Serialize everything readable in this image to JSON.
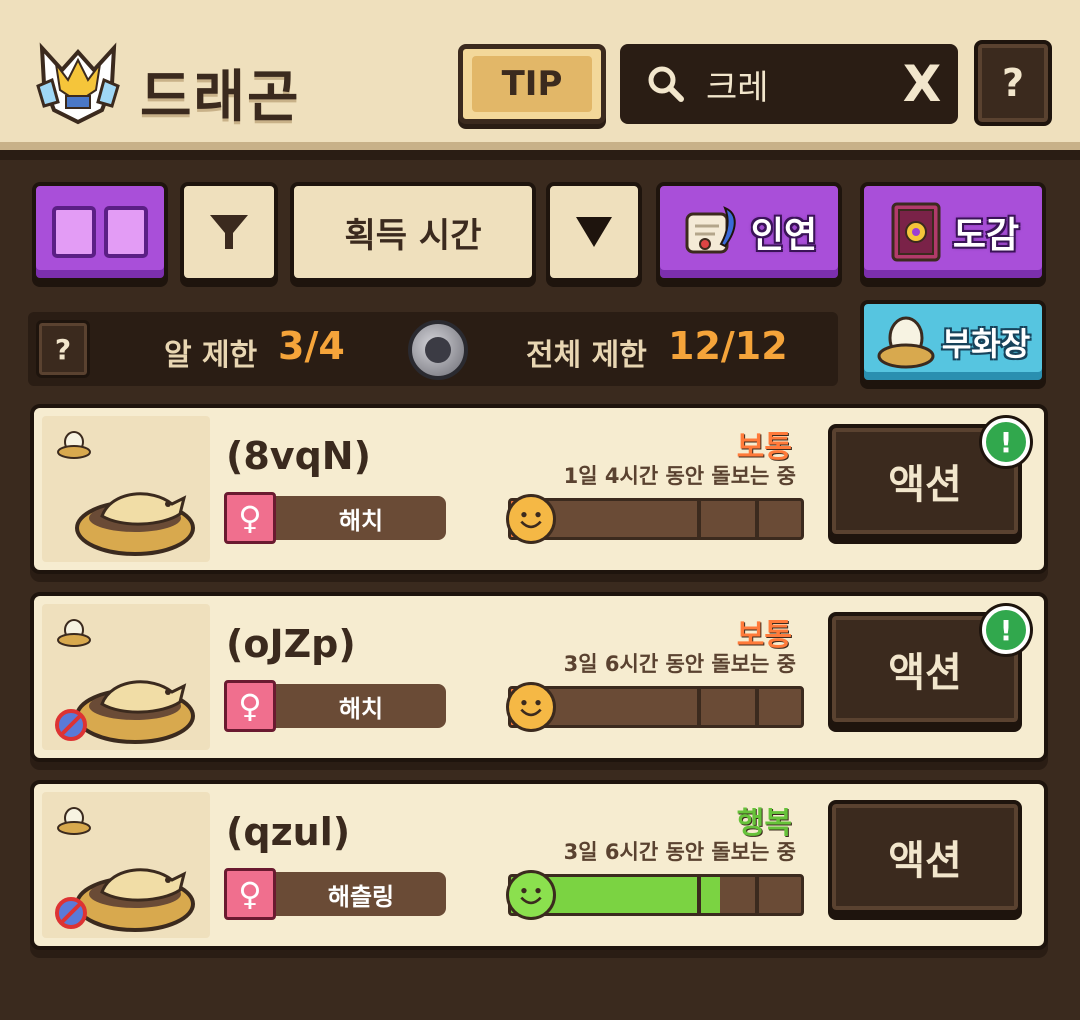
{
  "header": {
    "title": "드래곤",
    "tip_label": "TIP",
    "search_value": "크레",
    "clear_label": "X",
    "help_label": "?"
  },
  "toolbar": {
    "sort_label": "획득 시간",
    "inyeon_label": "인연",
    "dogam_label": "도감",
    "incubator_label": "부화장"
  },
  "limits": {
    "help_label": "?",
    "egg_limit_label": "알 제한",
    "egg_limit_value": "3/4",
    "total_limit_label": "전체 제한",
    "total_limit_value": "12/12"
  },
  "cards": [
    {
      "name": "(8vqN)",
      "gender": "♀",
      "stage": "해치",
      "mood": "보통",
      "mood_type": "normal",
      "care": "1일 4시간 동안 돌보는 중",
      "action": "액션",
      "alert": true,
      "happiness": 0.05,
      "noswap": false
    },
    {
      "name": "(oJZp)",
      "gender": "♀",
      "stage": "해치",
      "mood": "보통",
      "mood_type": "normal",
      "care": "3일 6시간 동안 돌보는 중",
      "action": "액션",
      "alert": true,
      "happiness": 0.05,
      "noswap": true
    },
    {
      "name": "(qzul)",
      "gender": "♀",
      "stage": "해츨링",
      "mood": "행복",
      "mood_type": "happy",
      "care": "3일 6시간 동안 돌보는 중",
      "action": "액션",
      "alert": false,
      "happiness": 0.72,
      "noswap": true
    }
  ],
  "colors": {
    "normal_fill": "#ff7a3a",
    "happy_fill": "#7bd342",
    "normal_face": "#f5b845",
    "happy_face": "#8be04e"
  }
}
